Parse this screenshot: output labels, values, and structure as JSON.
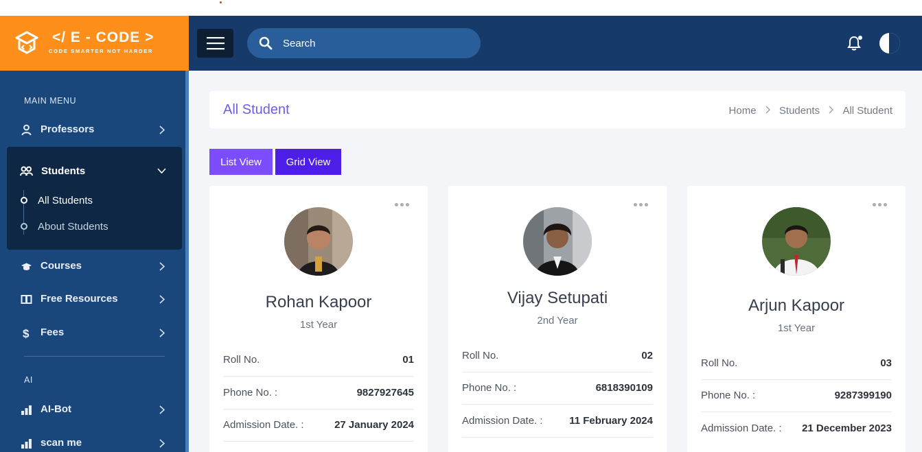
{
  "brand": {
    "title": "</ E - CODE >",
    "tagline": "CODE SMARTER NOT HARDER",
    "accent": "#fd8f1a"
  },
  "header": {
    "search_placeholder": "Search",
    "background": "#163a6a"
  },
  "sidebar": {
    "main_heading": "MAIN MENU",
    "ai_heading": "AI",
    "items": [
      {
        "label": "Professors",
        "icon": "user-icon"
      },
      {
        "label": "Students",
        "icon": "users-icon",
        "expanded": true
      },
      {
        "label": "Courses",
        "icon": "graduation-cap-icon"
      },
      {
        "label": "Free Resources",
        "icon": "book-icon"
      },
      {
        "label": "Fees",
        "icon": "dollar-icon"
      },
      {
        "label": "AI-Bot",
        "icon": "bar-chart-icon"
      },
      {
        "label": "scan me",
        "icon": "bar-chart-icon"
      }
    ],
    "students_submenu": [
      {
        "label": "All Students",
        "active": true
      },
      {
        "label": "About Students"
      }
    ]
  },
  "page": {
    "title": "All Student",
    "breadcrumb": [
      "Home",
      "Students",
      "All Student"
    ],
    "list_view_label": "List View",
    "grid_view_label": "Grid View"
  },
  "students": [
    {
      "name": "Rohan Kapoor",
      "year": "1st Year",
      "roll_label": "Roll No.",
      "roll": "01",
      "phone_label": "Phone No. :",
      "phone": "9827927645",
      "admission_label": "Admission Date. :",
      "admission": "27 January 2024"
    },
    {
      "name": "Vijay Setupati",
      "year": "2nd Year",
      "roll_label": "Roll No.",
      "roll": "02",
      "phone_label": "Phone No. :",
      "phone": "6818390109",
      "admission_label": "Admission Date. :",
      "admission": "11 February 2024"
    },
    {
      "name": "Arjun Kapoor",
      "year": "1st Year",
      "roll_label": "Roll No.",
      "roll": "03",
      "phone_label": "Phone No. :",
      "phone": "9287399190",
      "admission_label": "Admission Date. :",
      "admission": "21 December 2023"
    }
  ]
}
